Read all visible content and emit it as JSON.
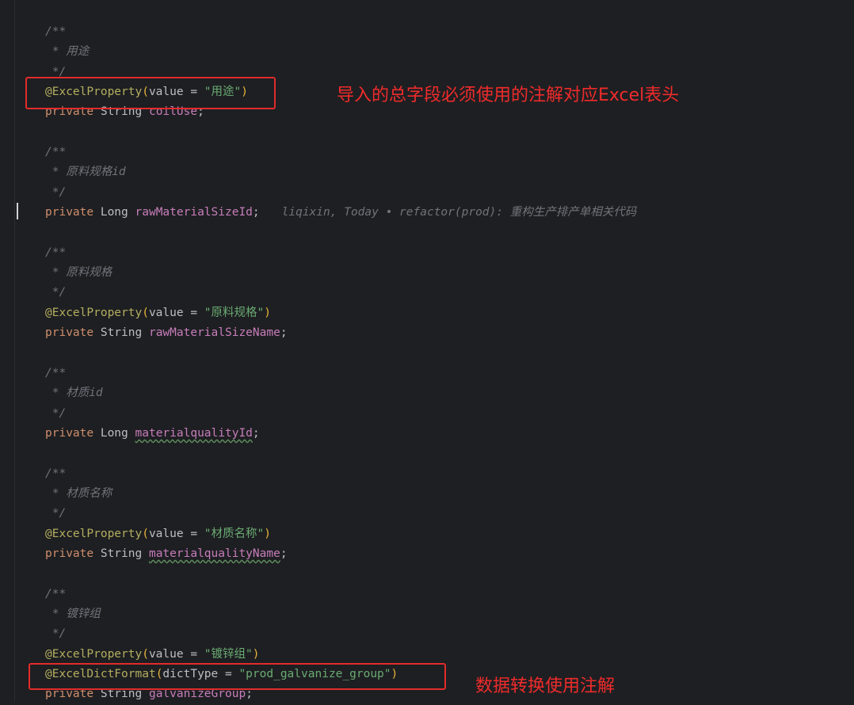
{
  "colors": {
    "background": "#1e1f22",
    "comment": "#6f737a",
    "annotation": "#b3ae60",
    "keyword": "#cf8e6d",
    "string": "#6aab73",
    "field": "#c77dbb",
    "highlight": "#e22b2b"
  },
  "code": {
    "doc_open": "/**",
    "doc_close": " */",
    "doc_star": " * ",
    "annotation_excel": "@ExcelProperty",
    "annotation_dict": "@ExcelDictFormat",
    "value_eq": "value = ",
    "dicttype_eq": "dictType = ",
    "kw_private": "private",
    "type_string": "String",
    "type_long": "Long",
    "blocks": [
      {
        "comment": "用途",
        "ann_value": "\"用途\"",
        "type": "String",
        "field": "coilUse"
      },
      {
        "comment": "原料规格id",
        "type": "Long",
        "field": "rawMaterialSizeId",
        "blame": "liqixin, Today • refactor(prod): 重构生产排产单相关代码"
      },
      {
        "comment": "原料规格",
        "ann_value": "\"原料规格\"",
        "type": "String",
        "field": "rawMaterialSizeName"
      },
      {
        "comment": "材质id",
        "type": "Long",
        "field": "materialqualityId"
      },
      {
        "comment": "材质名称",
        "ann_value": "\"材质名称\"",
        "type": "String",
        "field": "materialqualityName"
      },
      {
        "comment": "镀锌组",
        "ann_value": "\"镀锌组\"",
        "dict_value": "\"prod_galvanize_group\"",
        "type": "String",
        "field": "galvanizeGroup"
      }
    ]
  },
  "annotations": {
    "note1": "导入的总字段必须使用的注解对应Excel表头",
    "note2": "数据转换使用注解"
  }
}
